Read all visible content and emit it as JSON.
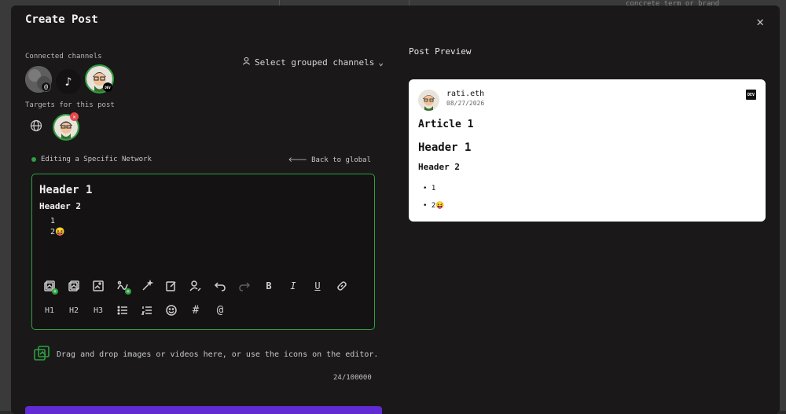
{
  "window": {
    "title": "Create Post",
    "close_icon": "close-icon",
    "background_text": "concrete term or brand"
  },
  "channels": {
    "connected_label": "Connected channels",
    "targets_label": "Targets for this post",
    "grouped_label": "Select grouped channels",
    "items": [
      {
        "name": "gray-avatar",
        "platform": "threads"
      },
      {
        "name": "tiktok-avatar",
        "platform": "tiktok"
      },
      {
        "name": "rati-avatar",
        "platform": "dev"
      }
    ]
  },
  "edit_mode": {
    "label": "Editing a Specific Network",
    "back_label": "Back to global"
  },
  "editor": {
    "h1": "Header 1",
    "h2": "Header 2",
    "list": [
      "1",
      "2😝"
    ]
  },
  "toolbar": {
    "row1": [
      "insert-media-icon",
      "media-library-icon",
      "image-edit-icon",
      "signature-icon",
      "ai-wand-icon",
      "edit-note-icon",
      "user-edit-icon",
      "undo-icon",
      "redo-icon",
      "bold-icon",
      "italic-icon",
      "underline-icon",
      "link-icon"
    ],
    "row2_labels": [
      "H1",
      "H2",
      "H3"
    ],
    "row2_icons": [
      "bullet-list-icon",
      "ordered-list-icon",
      "emoji-icon",
      "hashtag-icon",
      "mention-icon"
    ]
  },
  "dropzone": {
    "text": "Drag and drop images or videos here, or use the icons on the editor."
  },
  "counter": "24/100000",
  "preview": {
    "title": "Post Preview",
    "author": "rati.eth",
    "date": "08/27/2026",
    "badge": "DEV",
    "article": "Article 1",
    "h1": "Header 1",
    "h2": "Header 2",
    "list": [
      "1",
      "2😝"
    ]
  },
  "colors": {
    "accent_green": "#2ea043",
    "submit_purple": "#612bd3",
    "modal_bg": "#1a1818"
  }
}
